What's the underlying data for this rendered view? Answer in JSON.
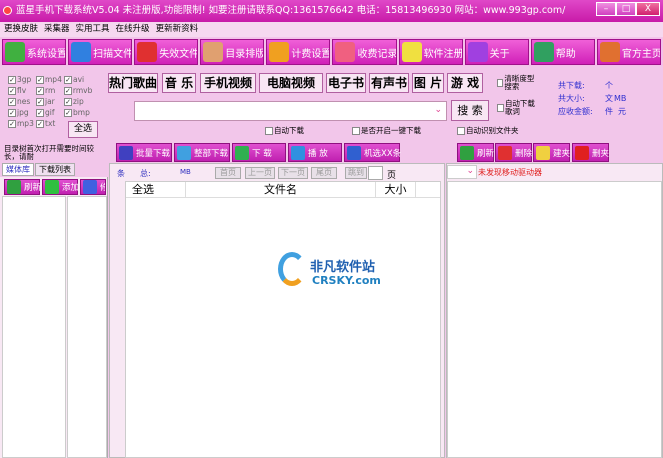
{
  "title": "蓝星手机下载系统V5.04  未注册版,功能限制! 如要注册请联系QQ:1361576642 电话：15813496930  网站：www.993gp.com/",
  "window_buttons": [
    "–",
    "□",
    "X"
  ],
  "menu": [
    "更换皮肤",
    "采集器",
    "实用工具",
    "在线升级",
    "更新新资料"
  ],
  "toolbar": [
    {
      "label": "系统设置",
      "color": "#40b040"
    },
    {
      "label": "扫描文件",
      "color": "#3080e0"
    },
    {
      "label": "失效文件",
      "color": "#e03030"
    },
    {
      "label": "目录排版",
      "color": "#e0a070"
    },
    {
      "label": "计费设置",
      "color": "#f0a020"
    },
    {
      "label": "收费记录",
      "color": "#f06080"
    },
    {
      "label": "软件注册",
      "color": "#f0e040"
    },
    {
      "label": "关于",
      "color": "#a040e0"
    },
    {
      "label": "帮助",
      "color": "#30a060"
    },
    {
      "label": "官方主页",
      "color": "#e07030"
    }
  ],
  "filetypes": [
    "3gp",
    "mp4",
    "avi",
    "flv",
    "rm",
    "rmvb",
    "nes",
    "jar",
    "zip",
    "jpg",
    "gif",
    "bmp",
    "mp3",
    "txt"
  ],
  "select_all_label": "全选",
  "categories": [
    "热门歌曲",
    "音 乐",
    "手机视频",
    "电脑视频",
    "电子书",
    "有声书",
    "图 片",
    "游 戏"
  ],
  "search": {
    "value": "",
    "button": "搜 索"
  },
  "options": {
    "precise": "清晰度型搜索",
    "auto_lyrics": "自动下载歌词",
    "auto_download": "自动下载",
    "one_click": "是否开启一键下载",
    "auto_folder": "自动识别文件夹"
  },
  "stats": {
    "total_files_label": "共下载:",
    "total_files_unit": "个文件",
    "total_size_label": "共大小:",
    "total_size_unit": "MB",
    "amount_label": "应收金额:",
    "amount_unit": "元"
  },
  "actions": [
    "批量下载",
    "整部下载",
    "下  载",
    "播  放",
    "机选XX条"
  ],
  "right_actions": [
    "刷新",
    "删除",
    "建夹",
    "删夹"
  ],
  "left": {
    "notice": "目录树首次打开需要时间较长，请耐",
    "tabs": [
      "媒体库",
      "下载列表"
    ],
    "buttons": [
      "刷新",
      "添加",
      "修"
    ]
  },
  "pager": {
    "count_label": "条",
    "total_label": "总:",
    "mb": "MB",
    "first": "首页",
    "prev": "上一页",
    "next": "下一页",
    "last": "尾页",
    "jump": "跳到",
    "page": "页"
  },
  "table": {
    "headers": [
      "全选",
      "文件名",
      "大小"
    ]
  },
  "drive": {
    "status": "未发现移动驱动器"
  },
  "watermark": {
    "cn": "非凡软件站",
    "en": "CRSKY.com"
  }
}
